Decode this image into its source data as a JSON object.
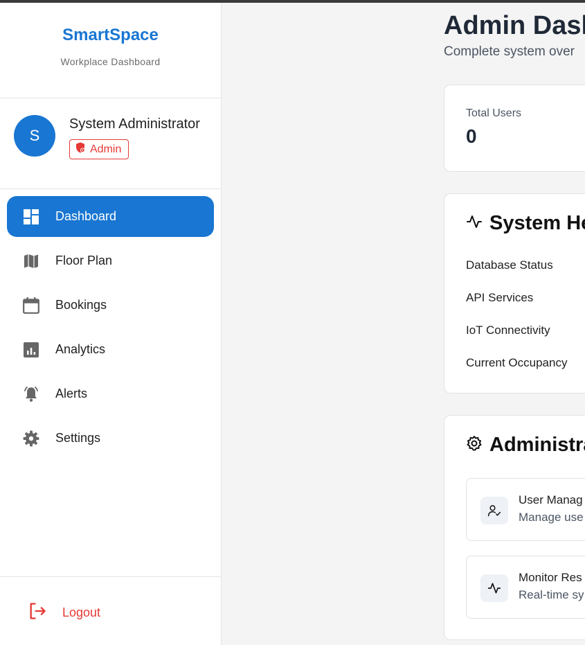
{
  "app": {
    "brand_title": "SmartSpace",
    "brand_subtitle": "Workplace Dashboard"
  },
  "user": {
    "initial": "S",
    "name": "System Administrator",
    "role": "Admin"
  },
  "nav": {
    "items": [
      {
        "label": "Dashboard",
        "icon": "dashboard-icon",
        "active": true
      },
      {
        "label": "Floor Plan",
        "icon": "map-icon"
      },
      {
        "label": "Bookings",
        "icon": "calendar-icon"
      },
      {
        "label": "Analytics",
        "icon": "analytics-icon"
      },
      {
        "label": "Alerts",
        "icon": "bell-alert-icon"
      },
      {
        "label": "Settings",
        "icon": "gear-icon"
      }
    ],
    "logout_label": "Logout"
  },
  "page": {
    "title": "Admin Dash",
    "subtitle": "Complete system over"
  },
  "stats": {
    "total_users_label": "Total Users",
    "total_users_value": "0"
  },
  "system_health": {
    "title": "System He",
    "rows": [
      "Database Status",
      "API Services",
      "IoT Connectivity",
      "Current Occupancy"
    ]
  },
  "administration": {
    "title": "Administra",
    "actions": [
      {
        "title": "User Manag",
        "desc": "Manage use",
        "icon": "user-check-icon"
      },
      {
        "title": "Monitor Res",
        "desc": "Real-time sy",
        "icon": "activity-icon"
      }
    ]
  },
  "colors": {
    "primary": "#1976d2",
    "danger": "#e53935",
    "background": "#f4f4f4"
  }
}
